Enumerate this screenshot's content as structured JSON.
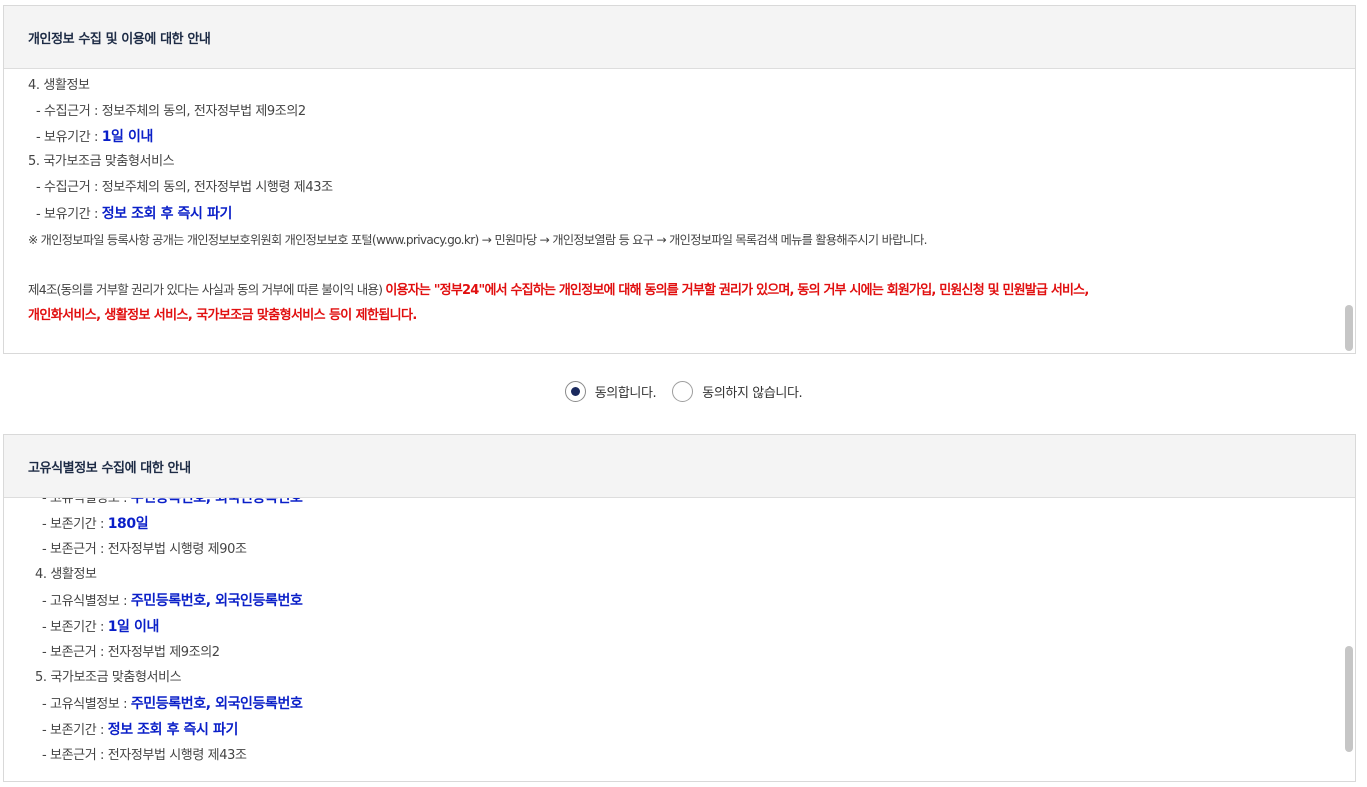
{
  "panel1": {
    "title": "개인정보 수집 및 이용에 대한 안내",
    "item4_heading": "4. 생활정보",
    "item4_basis_label": "- 수집근거 : ",
    "item4_basis_value": "정보주체의 동의, 전자정부법 제9조의2",
    "item4_period_label": "- 보유기간 : ",
    "item4_period_value": "1일 이내",
    "item5_heading": "5. 국가보조금 맞춤형서비스",
    "item5_basis_label": "- 수집근거 : ",
    "item5_basis_value": "정보주체의 동의, 전자정부법 시행령 제43조",
    "item5_period_label": "- 보유기간 : ",
    "item5_period_value": "정보 조회 후 즉시 파기",
    "note": "※ 개인정보파일 등록사항 공개는 개인정보보호위원회 개인정보보호 포털(www.privacy.go.kr) → 민원마당 → 개인정보열람 등 요구 → 개인정보파일 목록검색 메뉴를 활용해주시기 바랍니다.",
    "article_intro": "제4조(동의를 거부할 권리가 있다는 사실과 동의 거부에 따른 불이익 내용) ",
    "article_warning_1": "이용자는 \"정부24\"에서 수집하는 개인정보에 대해 동의를 거부할 권리가 있으며, 동의 거부 시에는 회원가입, 민원신청 및 민원발급 서비스,",
    "article_warning_2": "개인화서비스, 생활정보 서비스, 국가보조금 맞춤형서비스 등이 제한됩니다."
  },
  "consent": {
    "agree_label": "동의합니다.",
    "disagree_label": "동의하지 않습니다.",
    "selected": "agree"
  },
  "panel2": {
    "title": "고유식별정보 수집에 대한 안내",
    "clipped_label": "- 고유식별정보 : ",
    "clipped_value": "주민등록번호, 외국인등록번호",
    "prev_period_label": "- 보존기간 : ",
    "prev_period_value": "180일",
    "prev_basis_label": "- 보존근거 : ",
    "prev_basis_value": "전자정부법 시행령 제90조",
    "item4_heading": "4. 생활정보",
    "item4_id_label": "- 고유식별정보 : ",
    "item4_id_value": "주민등록번호, 외국인등록번호",
    "item4_period_label": "- 보존기간 : ",
    "item4_period_value": "1일 이내",
    "item4_basis_label": "- 보존근거 : ",
    "item4_basis_value": "전자정부법 제9조의2",
    "item5_heading": "5. 국가보조금 맞춤형서비스",
    "item5_id_label": "- 고유식별정보 : ",
    "item5_id_value": "주민등록번호, 외국인등록번호",
    "item5_period_label": "- 보존기간 : ",
    "item5_period_value": "정보 조회 후 즉시 파기",
    "item5_basis_label": "- 보존근거 : ",
    "item5_basis_value": "전자정부법 시행령 제43조"
  },
  "colors": {
    "emphasis_blue": "#0a1fc8",
    "warning_red": "#e10f0f",
    "header_text": "#1d2b45",
    "header_bg": "#f4f4f4"
  }
}
